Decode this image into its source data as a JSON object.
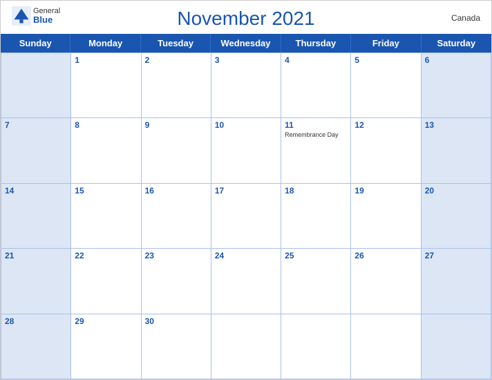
{
  "header": {
    "title": "November 2021",
    "country": "Canada",
    "logo_general": "General",
    "logo_blue": "Blue"
  },
  "days": [
    "Sunday",
    "Monday",
    "Tuesday",
    "Wednesday",
    "Thursday",
    "Friday",
    "Saturday"
  ],
  "weeks": [
    [
      {
        "date": "",
        "event": "",
        "sunday": true
      },
      {
        "date": "1",
        "event": ""
      },
      {
        "date": "2",
        "event": ""
      },
      {
        "date": "3",
        "event": ""
      },
      {
        "date": "4",
        "event": ""
      },
      {
        "date": "5",
        "event": ""
      },
      {
        "date": "6",
        "event": "",
        "saturday": true
      }
    ],
    [
      {
        "date": "7",
        "event": "",
        "sunday": true
      },
      {
        "date": "8",
        "event": ""
      },
      {
        "date": "9",
        "event": ""
      },
      {
        "date": "10",
        "event": ""
      },
      {
        "date": "11",
        "event": "Remembrance Day"
      },
      {
        "date": "12",
        "event": ""
      },
      {
        "date": "13",
        "event": "",
        "saturday": true
      }
    ],
    [
      {
        "date": "14",
        "event": "",
        "sunday": true
      },
      {
        "date": "15",
        "event": ""
      },
      {
        "date": "16",
        "event": ""
      },
      {
        "date": "17",
        "event": ""
      },
      {
        "date": "18",
        "event": ""
      },
      {
        "date": "19",
        "event": ""
      },
      {
        "date": "20",
        "event": "",
        "saturday": true
      }
    ],
    [
      {
        "date": "21",
        "event": "",
        "sunday": true
      },
      {
        "date": "22",
        "event": ""
      },
      {
        "date": "23",
        "event": ""
      },
      {
        "date": "24",
        "event": ""
      },
      {
        "date": "25",
        "event": ""
      },
      {
        "date": "26",
        "event": ""
      },
      {
        "date": "27",
        "event": "",
        "saturday": true
      }
    ],
    [
      {
        "date": "28",
        "event": "",
        "sunday": true
      },
      {
        "date": "29",
        "event": ""
      },
      {
        "date": "30",
        "event": ""
      },
      {
        "date": "",
        "event": ""
      },
      {
        "date": "",
        "event": ""
      },
      {
        "date": "",
        "event": ""
      },
      {
        "date": "",
        "event": "",
        "saturday": true
      }
    ]
  ]
}
